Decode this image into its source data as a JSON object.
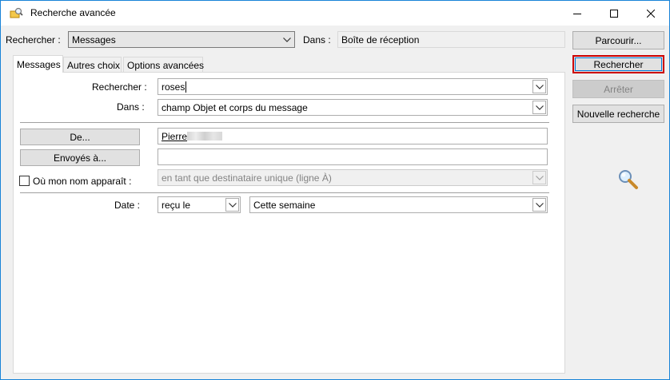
{
  "window": {
    "title": "Recherche avancée"
  },
  "top": {
    "search_label": "Rechercher :",
    "search_value": "Messages",
    "in_label": "Dans :",
    "in_value": "Boîte de réception"
  },
  "side_buttons": {
    "browse": "Parcourir...",
    "search": "Rechercher",
    "stop": "Arrêter",
    "new_search": "Nouvelle recherche"
  },
  "tabs": [
    {
      "label": "Messages",
      "active": true
    },
    {
      "label": "Autres choix",
      "active": false
    },
    {
      "label": "Options avancées",
      "active": false
    }
  ],
  "messages_tab": {
    "search_for_label": "Rechercher :",
    "search_for_value": "roses",
    "in_label": "Dans :",
    "in_value": "champ Objet et corps du message",
    "from_button": "De...",
    "from_value": "Pierre",
    "sent_to_button": "Envoyés à...",
    "sent_to_value": "",
    "where_my_name_label": "Où mon nom apparaît :",
    "where_my_name_checked": false,
    "where_my_name_value": "en tant que destinataire unique (ligne À)",
    "date_label": "Date :",
    "date_type_value": "reçu le",
    "date_range_value": "Cette semaine"
  },
  "colors": {
    "accent_border": "#1883d7",
    "default_button_border": "#cc0000"
  }
}
